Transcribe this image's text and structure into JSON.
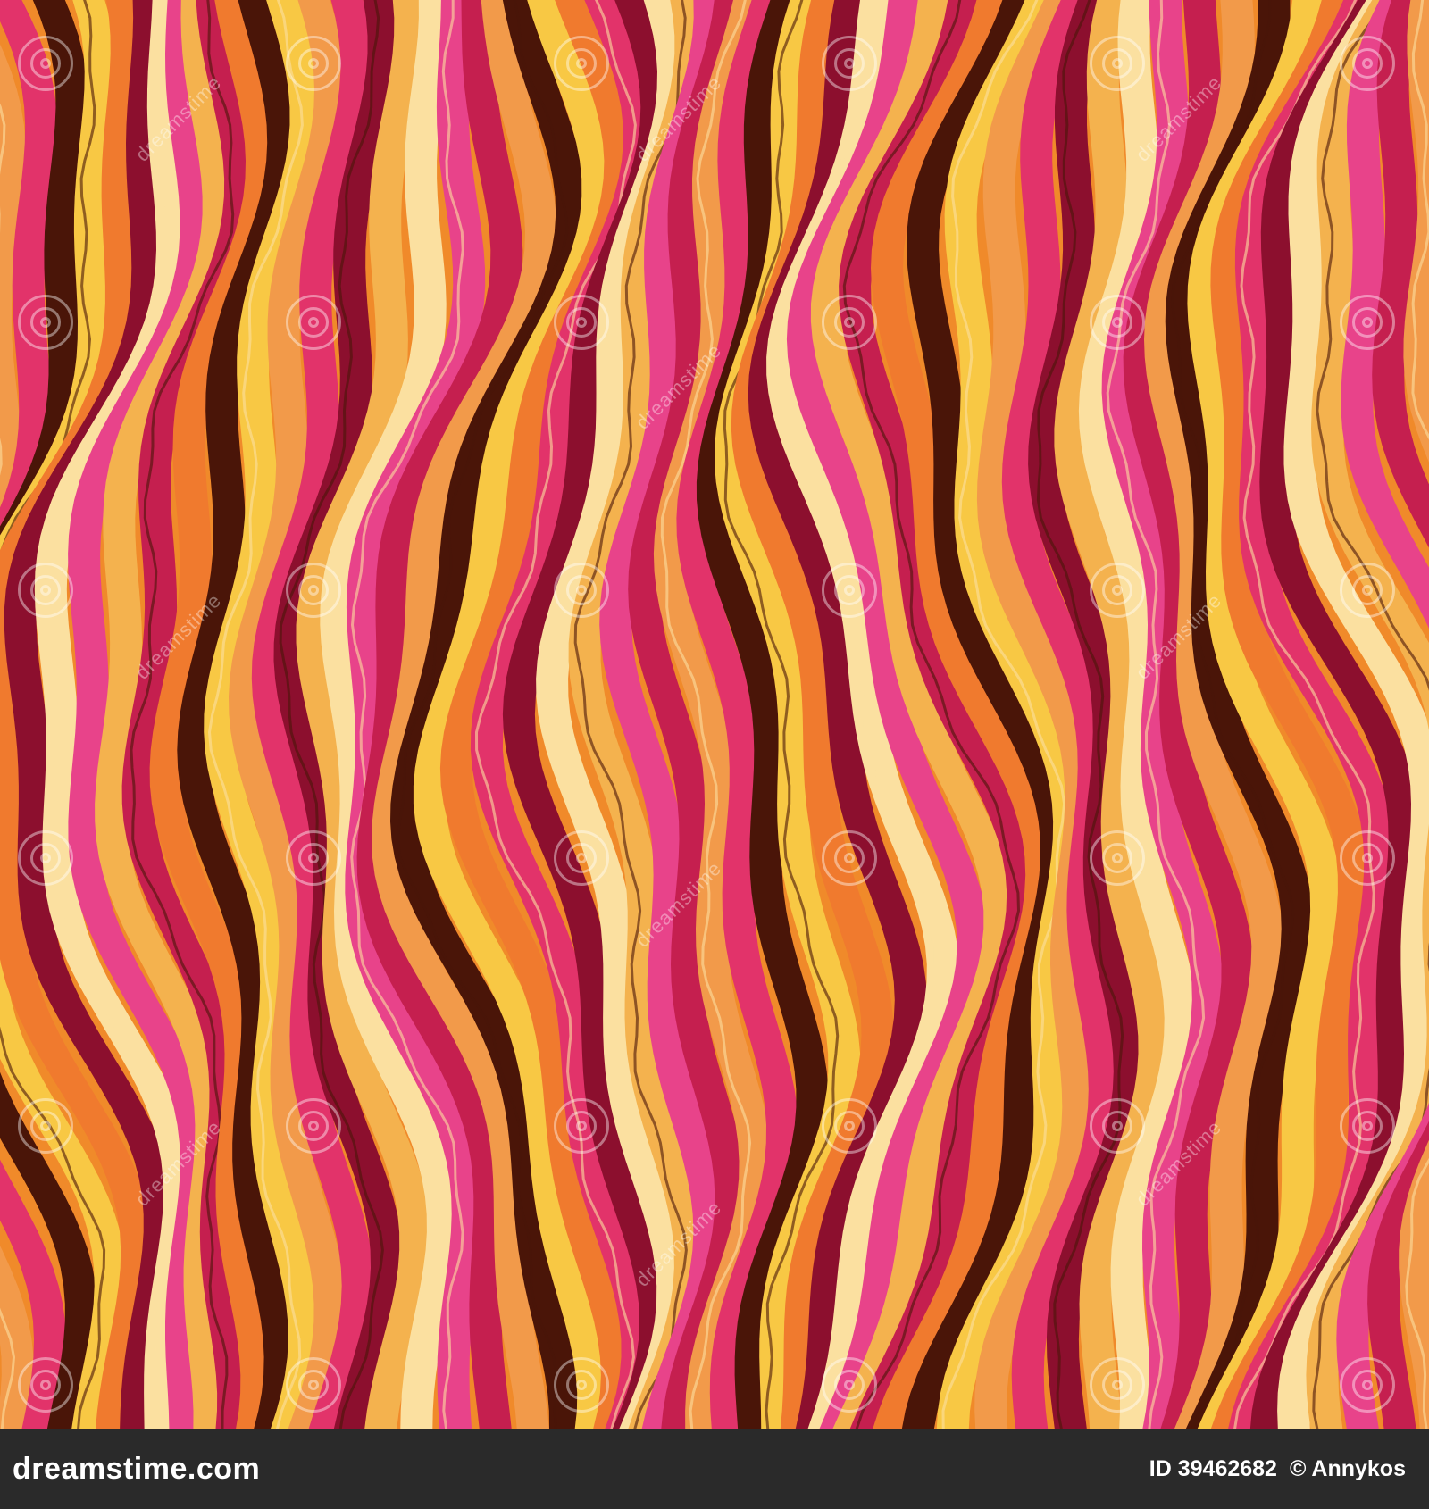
{
  "artwork": {
    "palette": [
      "#4a1508",
      "#8c0f2e",
      "#c51f4f",
      "#e2336a",
      "#e8438a",
      "#f07a2e",
      "#f29a4a",
      "#f4b24e",
      "#f8c844",
      "#fbe0a0"
    ],
    "background": "#f08a2a"
  },
  "watermark": {
    "text": "dreamstime",
    "logo_icon": "dreamstime-spiral-icon"
  },
  "footer": {
    "site": "dreamstime.com",
    "id_label": "ID 39462682",
    "copyright": "© Annykos"
  }
}
